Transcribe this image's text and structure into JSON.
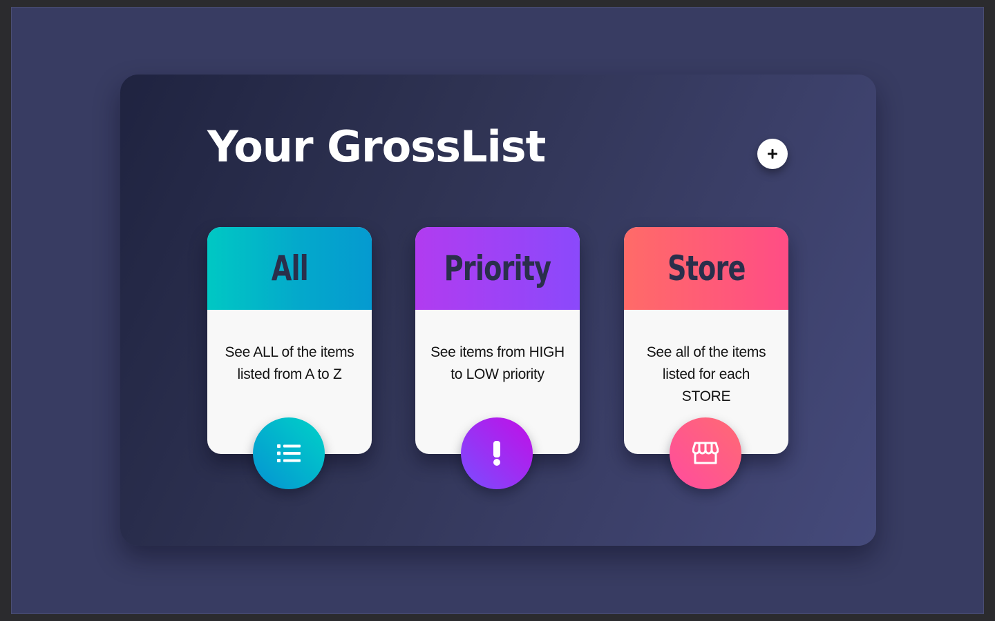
{
  "header": {
    "title": "Your GrossList",
    "add_button_icon": "plus-icon"
  },
  "cards": [
    {
      "heading": "All",
      "description": "See ALL of the items listed from A to Z",
      "icon": "list-icon",
      "colors": [
        "#00c8c4",
        "#059ad0"
      ]
    },
    {
      "heading": "Priority",
      "description": "See items from HIGH to LOW priority",
      "icon": "exclamation-icon",
      "colors": [
        "#b13cf0",
        "#8b49fb"
      ]
    },
    {
      "heading": "Store",
      "description": "See all of the items listed for each STORE",
      "icon": "store-icon",
      "colors": [
        "#ff6b68",
        "#ff4d85"
      ]
    }
  ],
  "theme": {
    "panel_dark": "#1f2340",
    "panel_light": "#454a7b",
    "heading_text": "#2a2f4b"
  }
}
